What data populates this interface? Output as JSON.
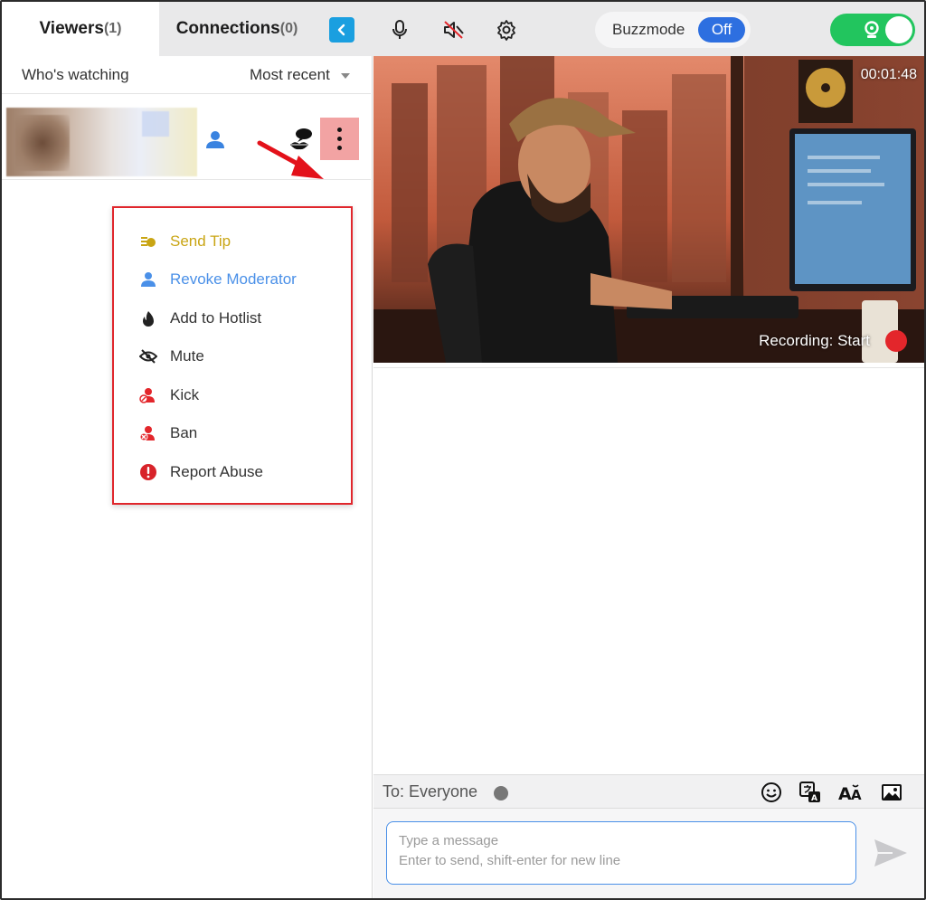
{
  "tabs": {
    "viewers_label": "Viewers",
    "viewers_count": "(1)",
    "connections_label": "Connections",
    "connections_count": "(0)"
  },
  "toolbar": {
    "buzzmode_label": "Buzzmode",
    "buzzmode_state": "Off",
    "camera_toggle": "on"
  },
  "viewers_panel": {
    "who_label": "Who's watching",
    "sort_label": "Most recent"
  },
  "context_menu": {
    "items": [
      {
        "label": "Send Tip",
        "icon": "coins-icon"
      },
      {
        "label": "Revoke Moderator",
        "icon": "moderator-icon"
      },
      {
        "label": "Add to Hotlist",
        "icon": "flame-icon"
      },
      {
        "label": "Mute",
        "icon": "eye-slash-icon"
      },
      {
        "label": "Kick",
        "icon": "user-kick-icon"
      },
      {
        "label": "Ban",
        "icon": "user-ban-icon"
      },
      {
        "label": "Report Abuse",
        "icon": "alert-icon"
      }
    ]
  },
  "video": {
    "timer": "00:01:48",
    "recording_label": "Recording: Start"
  },
  "chat": {
    "to_label": "To: Everyone",
    "placeholder_line1": "Type a message",
    "placeholder_line2": "Enter to send, shift-enter for new line"
  },
  "colors": {
    "accent_blue": "#2d6fe0",
    "toggle_green": "#22c55e",
    "highlight_red": "#e0262c",
    "tip_gold": "#c9a514",
    "moderator_blue": "#4a90e8",
    "recording_red": "#e3262b"
  }
}
